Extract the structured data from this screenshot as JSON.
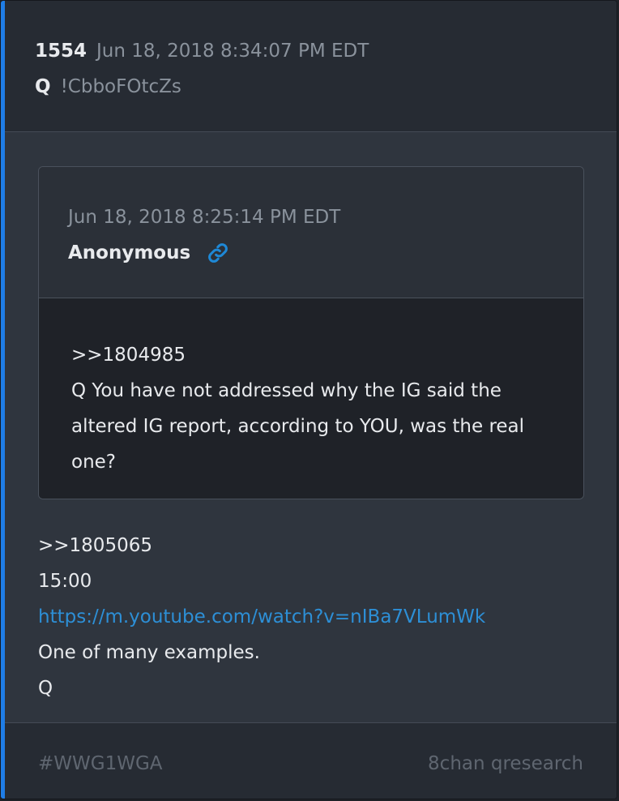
{
  "post": {
    "number": "1554",
    "date": "Jun 18, 2018 8:34:07 PM EDT",
    "author": "Q",
    "tripcode": "!CbboFOtcZs"
  },
  "quoted_post": {
    "date": "Jun 18, 2018 8:25:14 PM EDT",
    "author": "Anonymous",
    "link_icon": "link-icon",
    "lines": [
      ">>1804985",
      "Q You have not addressed why the IG said the",
      "altered IG report, according to YOU, was the real",
      "one?"
    ]
  },
  "body": {
    "line1": ">>1805065",
    "line2": "15:00",
    "link": "https://m.youtube.com/watch?v=nIBa7VLumWk",
    "line4": "One of many examples.",
    "line5": "Q"
  },
  "footer": {
    "hashtag": "#WWG1WGA",
    "source": "8chan qresearch"
  },
  "colors": {
    "accent": "#1f7de6",
    "link": "#2d8fd6"
  }
}
